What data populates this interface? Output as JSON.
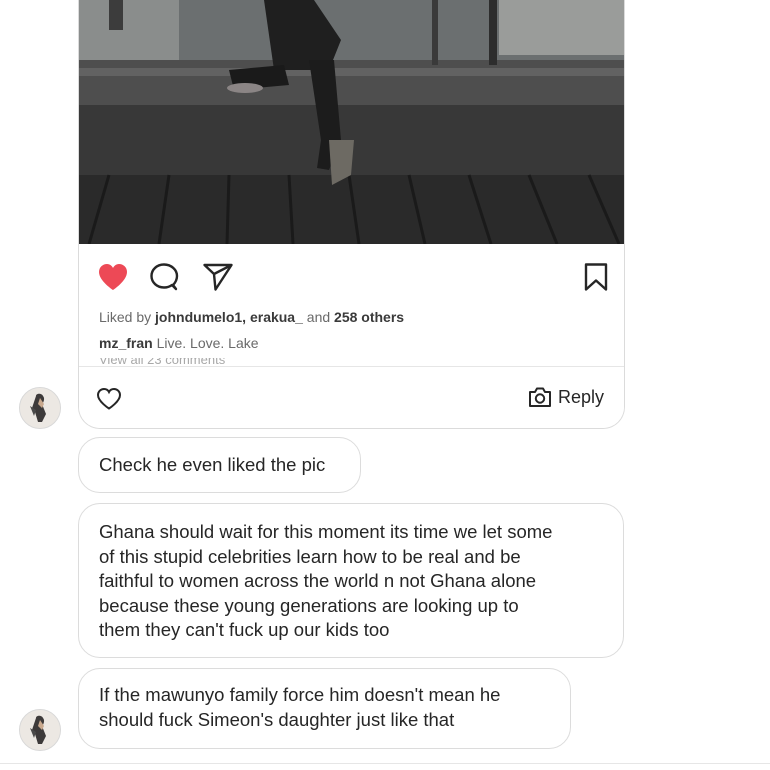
{
  "post": {
    "liked_by_prefix": "Liked by ",
    "liked_user_1": "johndumelo1",
    "liked_sep": ", ",
    "liked_user_2": "erakua_",
    "liked_and": " and ",
    "liked_others": "258 others",
    "caption_user": "mz_fran",
    "caption_text": " Live. Love. Lake",
    "comments_link_faded": "View all 23 comments"
  },
  "footer": {
    "reply_label": "Reply"
  },
  "messages": [
    {
      "lines": [
        "Check he even liked the pic"
      ]
    },
    {
      "lines": [
        "Ghana should wait for this moment its time we let some",
        "of  this stupid celebrities learn how to be real and be",
        "faithful to women across the world n not Ghana alone",
        "because these young generations are looking up to",
        "them they can't fuck up our kids too"
      ]
    },
    {
      "lines": [
        "If the mawunyo family force him doesn't mean he",
        "should fuck Simeon's daughter just like that"
      ]
    }
  ],
  "colors": {
    "heart": "#ed4956",
    "text": "#262626",
    "muted": "#6a6a6a",
    "border": "#dbdbdb"
  },
  "icons": [
    "heart-filled-icon",
    "comment-icon",
    "share-icon",
    "bookmark-icon",
    "heart-outline-icon",
    "camera-icon"
  ]
}
